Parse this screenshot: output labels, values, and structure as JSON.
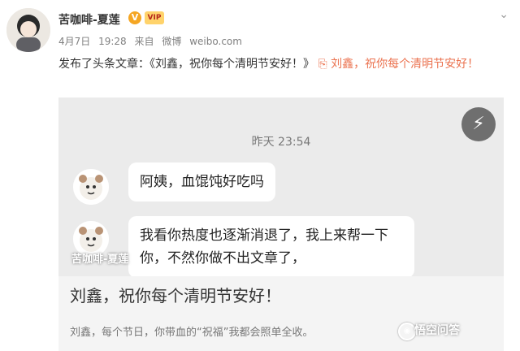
{
  "user": {
    "name": "苦咖啡-夏莲",
    "verify_badge": "V",
    "vip_badge": "VIP"
  },
  "meta": {
    "date": "4月7日",
    "time": "19:28",
    "from_label": "来自",
    "source": "微博",
    "domain": "weibo.com"
  },
  "post": {
    "text_prefix": "发布了头条文章：",
    "article_quote": "《刘鑫，祝你每个清明节安好！》",
    "link_text": "刘鑫，祝你每个清明节安好！"
  },
  "chat": {
    "timestamp": "昨天 23:54",
    "messages": [
      {
        "text": "阿姨，血馄饨好吃吗"
      },
      {
        "text": "我看你热度也逐渐消退了，我上来帮一下你，不然你做不出文章了，"
      }
    ],
    "watermark": "苦咖啡-夏莲"
  },
  "card": {
    "title": "刘鑫，祝你每个清明节安好！",
    "description": "刘鑫，每个节日，你带血的“祝福”我都会照单全收。"
  },
  "branding": {
    "text": "悟空问答"
  },
  "icons": {
    "more": "chevron-down-icon",
    "flash": "lightning-icon",
    "link": "link-icon"
  },
  "colors": {
    "link": "#eb7350",
    "chat_bg": "#ebebeb",
    "card_bg": "#f4f4f4"
  }
}
